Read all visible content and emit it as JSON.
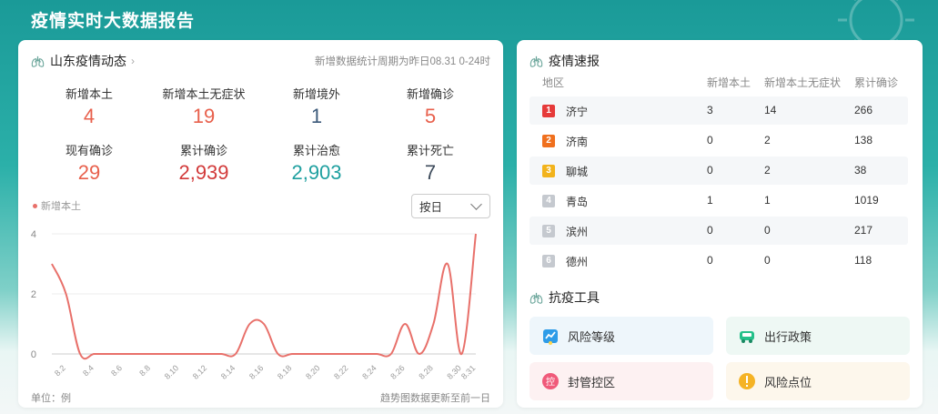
{
  "page": {
    "title": "疫情实时大数据报告"
  },
  "dynamics": {
    "title": "山东疫情动态",
    "period_note": "新增数据统计周期为昨日08.31 0-24时",
    "stats": [
      {
        "label": "新增本土",
        "value": "4",
        "color": "#e8604c"
      },
      {
        "label": "新增本土无症状",
        "value": "19",
        "color": "#e8604c"
      },
      {
        "label": "新增境外",
        "value": "1",
        "color": "#3c5a7a"
      },
      {
        "label": "新增确诊",
        "value": "5",
        "color": "#e8604c"
      },
      {
        "label": "现有确诊",
        "value": "29",
        "color": "#e8604c"
      },
      {
        "label": "累计确诊",
        "value": "2,939",
        "color": "#d23a3a"
      },
      {
        "label": "累计治愈",
        "value": "2,903",
        "color": "#1fa0a0"
      },
      {
        "label": "累计死亡",
        "value": "7",
        "color": "#3c4a5a"
      }
    ],
    "legend": "新增本土",
    "period_select": "按日",
    "unit_note": "单位：例",
    "update_note": "趋势图数据更新至前一日"
  },
  "chart_data": {
    "type": "line",
    "x": [
      "8.1",
      "8.2",
      "8.3",
      "8.4",
      "8.5",
      "8.6",
      "8.7",
      "8.8",
      "8.9",
      "8.10",
      "8.11",
      "8.12",
      "8.13",
      "8.14",
      "8.15",
      "8.16",
      "8.17",
      "8.18",
      "8.19",
      "8.20",
      "8.21",
      "8.22",
      "8.23",
      "8.24",
      "8.25",
      "8.26",
      "8.27",
      "8.28",
      "8.29",
      "8.30",
      "8.31"
    ],
    "tick_labels": [
      "8.2",
      "8.4",
      "8.6",
      "8.8",
      "8.10",
      "8.12",
      "8.14",
      "8.16",
      "8.18",
      "8.20",
      "8.22",
      "8.24",
      "8.26",
      "8.28",
      "8.30",
      "8.31"
    ],
    "series": [
      {
        "name": "新增本土",
        "values": [
          3,
          2,
          0,
          0,
          0,
          0,
          0,
          0,
          0,
          0,
          0,
          0,
          0,
          0,
          1,
          1,
          0,
          0,
          0,
          0,
          0,
          0,
          0,
          0,
          0,
          1,
          0,
          1,
          3,
          0,
          4
        ],
        "color": "#e8706a"
      }
    ],
    "yticks": [
      "0",
      "2",
      "4"
    ],
    "ylim": [
      0,
      4
    ],
    "grid": true
  },
  "report": {
    "title": "疫情速报",
    "columns": [
      "地区",
      "新增本土",
      "新增本土无症状",
      "累计确诊"
    ],
    "rows": [
      {
        "rank": "1",
        "rank_color": "#e63a3a",
        "region": "济宁",
        "new_local": "3",
        "asym": "14",
        "total": "266"
      },
      {
        "rank": "2",
        "rank_color": "#f0701e",
        "region": "济南",
        "new_local": "0",
        "asym": "2",
        "total": "138"
      },
      {
        "rank": "3",
        "rank_color": "#f2b31c",
        "region": "聊城",
        "new_local": "0",
        "asym": "2",
        "total": "38"
      },
      {
        "rank": "4",
        "rank_color": "#c5c9cf",
        "region": "青岛",
        "new_local": "1",
        "asym": "1",
        "total": "1019"
      },
      {
        "rank": "5",
        "rank_color": "#c5c9cf",
        "region": "滨州",
        "new_local": "0",
        "asym": "0",
        "total": "217"
      },
      {
        "rank": "6",
        "rank_color": "#c5c9cf",
        "region": "德州",
        "new_local": "0",
        "asym": "0",
        "total": "118"
      }
    ]
  },
  "tools": {
    "title": "抗疫工具",
    "items": [
      {
        "label": "风险等级",
        "icon": "risk-level-icon",
        "bg": "#eef6fb"
      },
      {
        "label": "出行政策",
        "icon": "car-icon",
        "bg": "#eef8f4"
      },
      {
        "label": "封管控区",
        "icon": "control-zone-icon",
        "bg": "#fdf1f2"
      },
      {
        "label": "风险点位",
        "icon": "warning-icon",
        "bg": "#fdf7ec"
      }
    ]
  }
}
